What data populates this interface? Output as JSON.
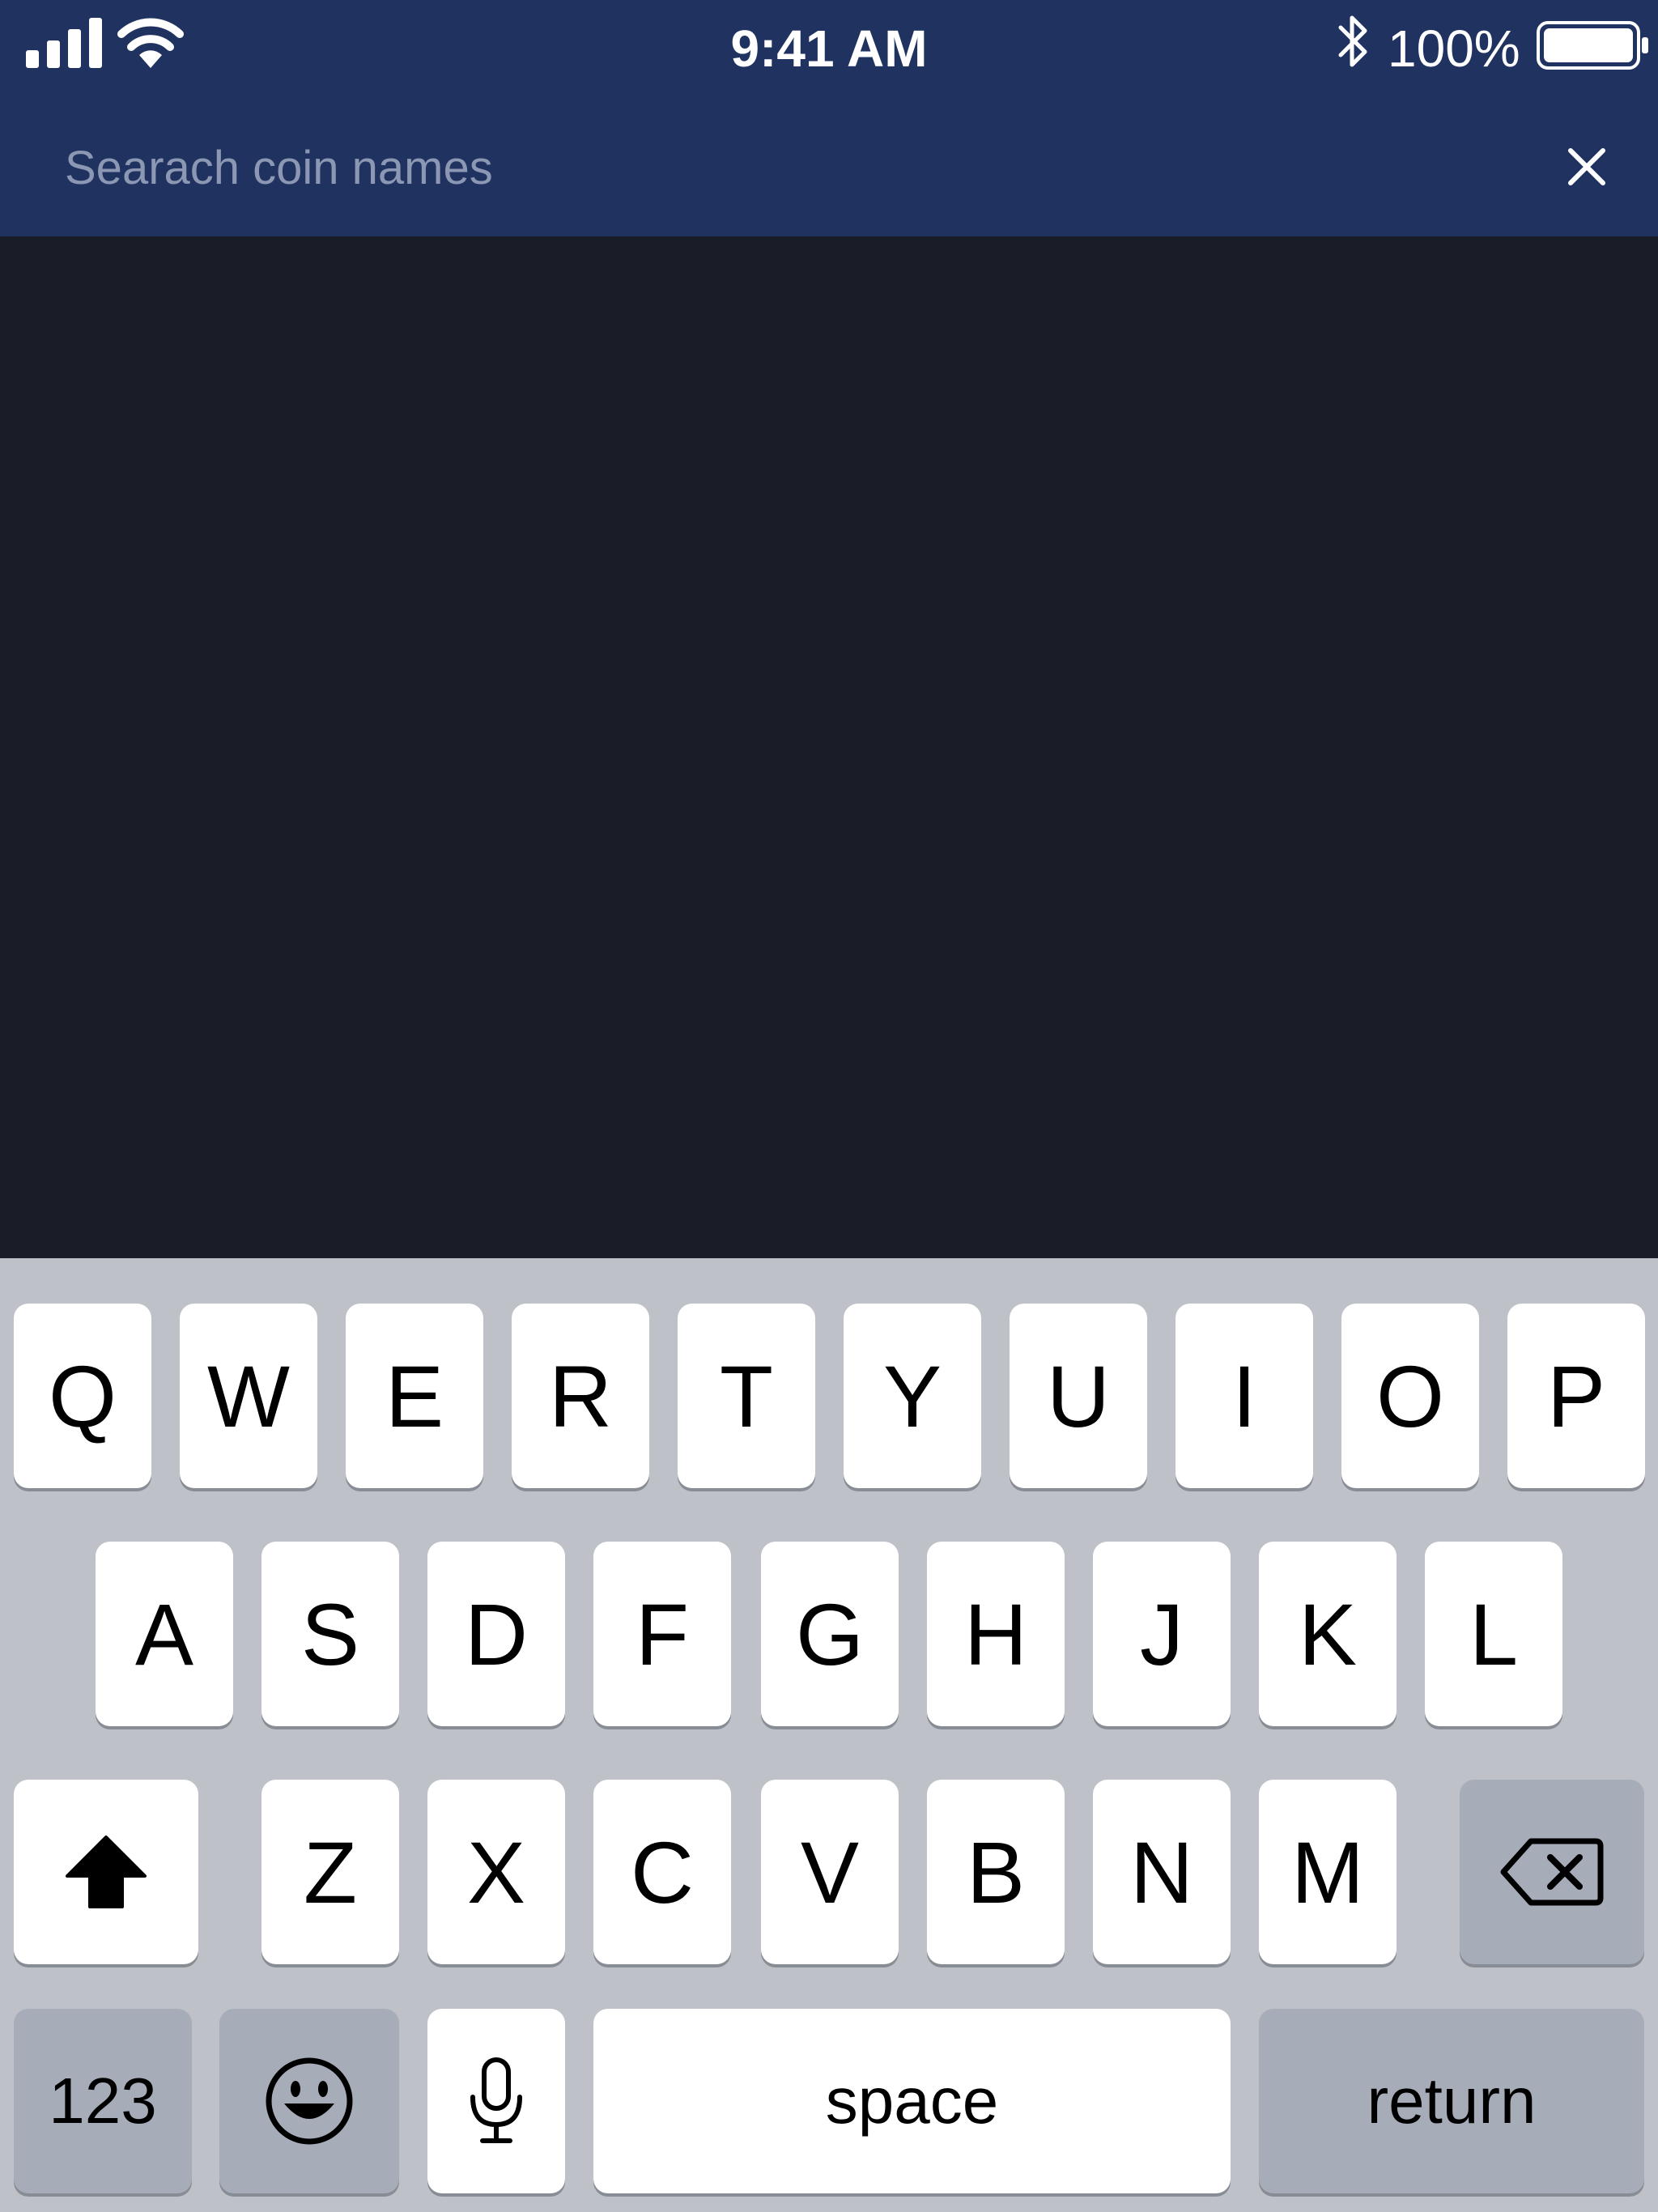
{
  "status_bar": {
    "time": "9:41 AM",
    "battery_percent": "100%",
    "battery_level": 1.0,
    "icons": [
      "signal-icon",
      "wifi-icon",
      "bluetooth-icon",
      "battery-icon"
    ]
  },
  "search": {
    "placeholder": "Searach coin names",
    "value": ""
  },
  "colors": {
    "header_bg": "#1f3260",
    "content_bg": "#1a1d27",
    "keyboard_bg": "#bec1c8",
    "key_bg": "#ffffff",
    "special_key_bg": "#a6acb8",
    "placeholder": "#8c97b3"
  },
  "keyboard": {
    "row1": [
      "Q",
      "W",
      "E",
      "R",
      "T",
      "Y",
      "U",
      "I",
      "O",
      "P"
    ],
    "row2": [
      "A",
      "S",
      "D",
      "F",
      "G",
      "H",
      "J",
      "K",
      "L"
    ],
    "row3": [
      "Z",
      "X",
      "C",
      "V",
      "B",
      "N",
      "M"
    ],
    "numbers_label": "123",
    "space_label": "space",
    "return_label": "return",
    "special_icons": [
      "shift-icon",
      "backspace-icon",
      "emoji-icon",
      "microphone-icon"
    ]
  }
}
